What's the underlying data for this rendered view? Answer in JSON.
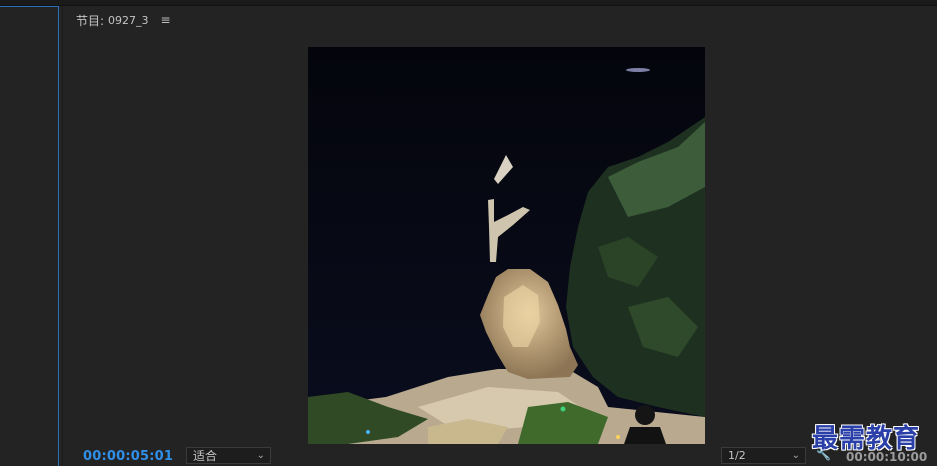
{
  "panel": {
    "title": "节目:",
    "sequence_name": "0927_3",
    "menu_icon": "hamburger-menu-icon"
  },
  "playback": {
    "current_timecode": "00:00:05:01",
    "duration_timecode": "00:00:10:00"
  },
  "controls": {
    "fit_label": "适合",
    "resolution_label": "1/2",
    "settings_icon": "wrench-icon"
  },
  "watermark": {
    "text": "最需教育"
  },
  "colors": {
    "accent_blue": "#2f8fe8",
    "panel_bg": "#232323",
    "selected_border": "#2d6fb8"
  }
}
